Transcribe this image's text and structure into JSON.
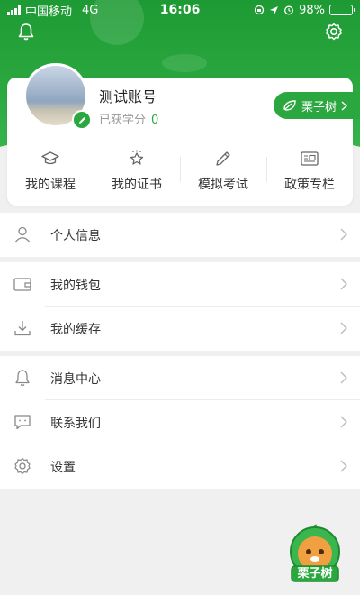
{
  "status_bar": {
    "carrier": "中国移动",
    "network": "4G",
    "time": "16:06",
    "battery": "98%"
  },
  "profile": {
    "account_name": "测试账号",
    "credit_label": "已获学分",
    "credit_value": "0",
    "brand_button": "栗子树"
  },
  "quick_actions": [
    {
      "label": "我的课程",
      "icon": "graduation-cap-icon"
    },
    {
      "label": "我的证书",
      "icon": "certificate-icon"
    },
    {
      "label": "模拟考试",
      "icon": "pencil-icon"
    },
    {
      "label": "政策专栏",
      "icon": "policy-card-icon"
    }
  ],
  "menu_groups": [
    [
      {
        "label": "个人信息",
        "icon": "user-icon"
      }
    ],
    [
      {
        "label": "我的钱包",
        "icon": "wallet-icon"
      },
      {
        "label": "我的缓存",
        "icon": "download-icon"
      }
    ],
    [
      {
        "label": "消息中心",
        "icon": "bell-icon"
      },
      {
        "label": "联系我们",
        "icon": "chat-icon"
      },
      {
        "label": "设置",
        "icon": "gear-icon"
      }
    ]
  ],
  "mascot": {
    "text": "栗子树"
  },
  "colors": {
    "accent": "#2aa83f",
    "background": "#f0f0f0"
  }
}
